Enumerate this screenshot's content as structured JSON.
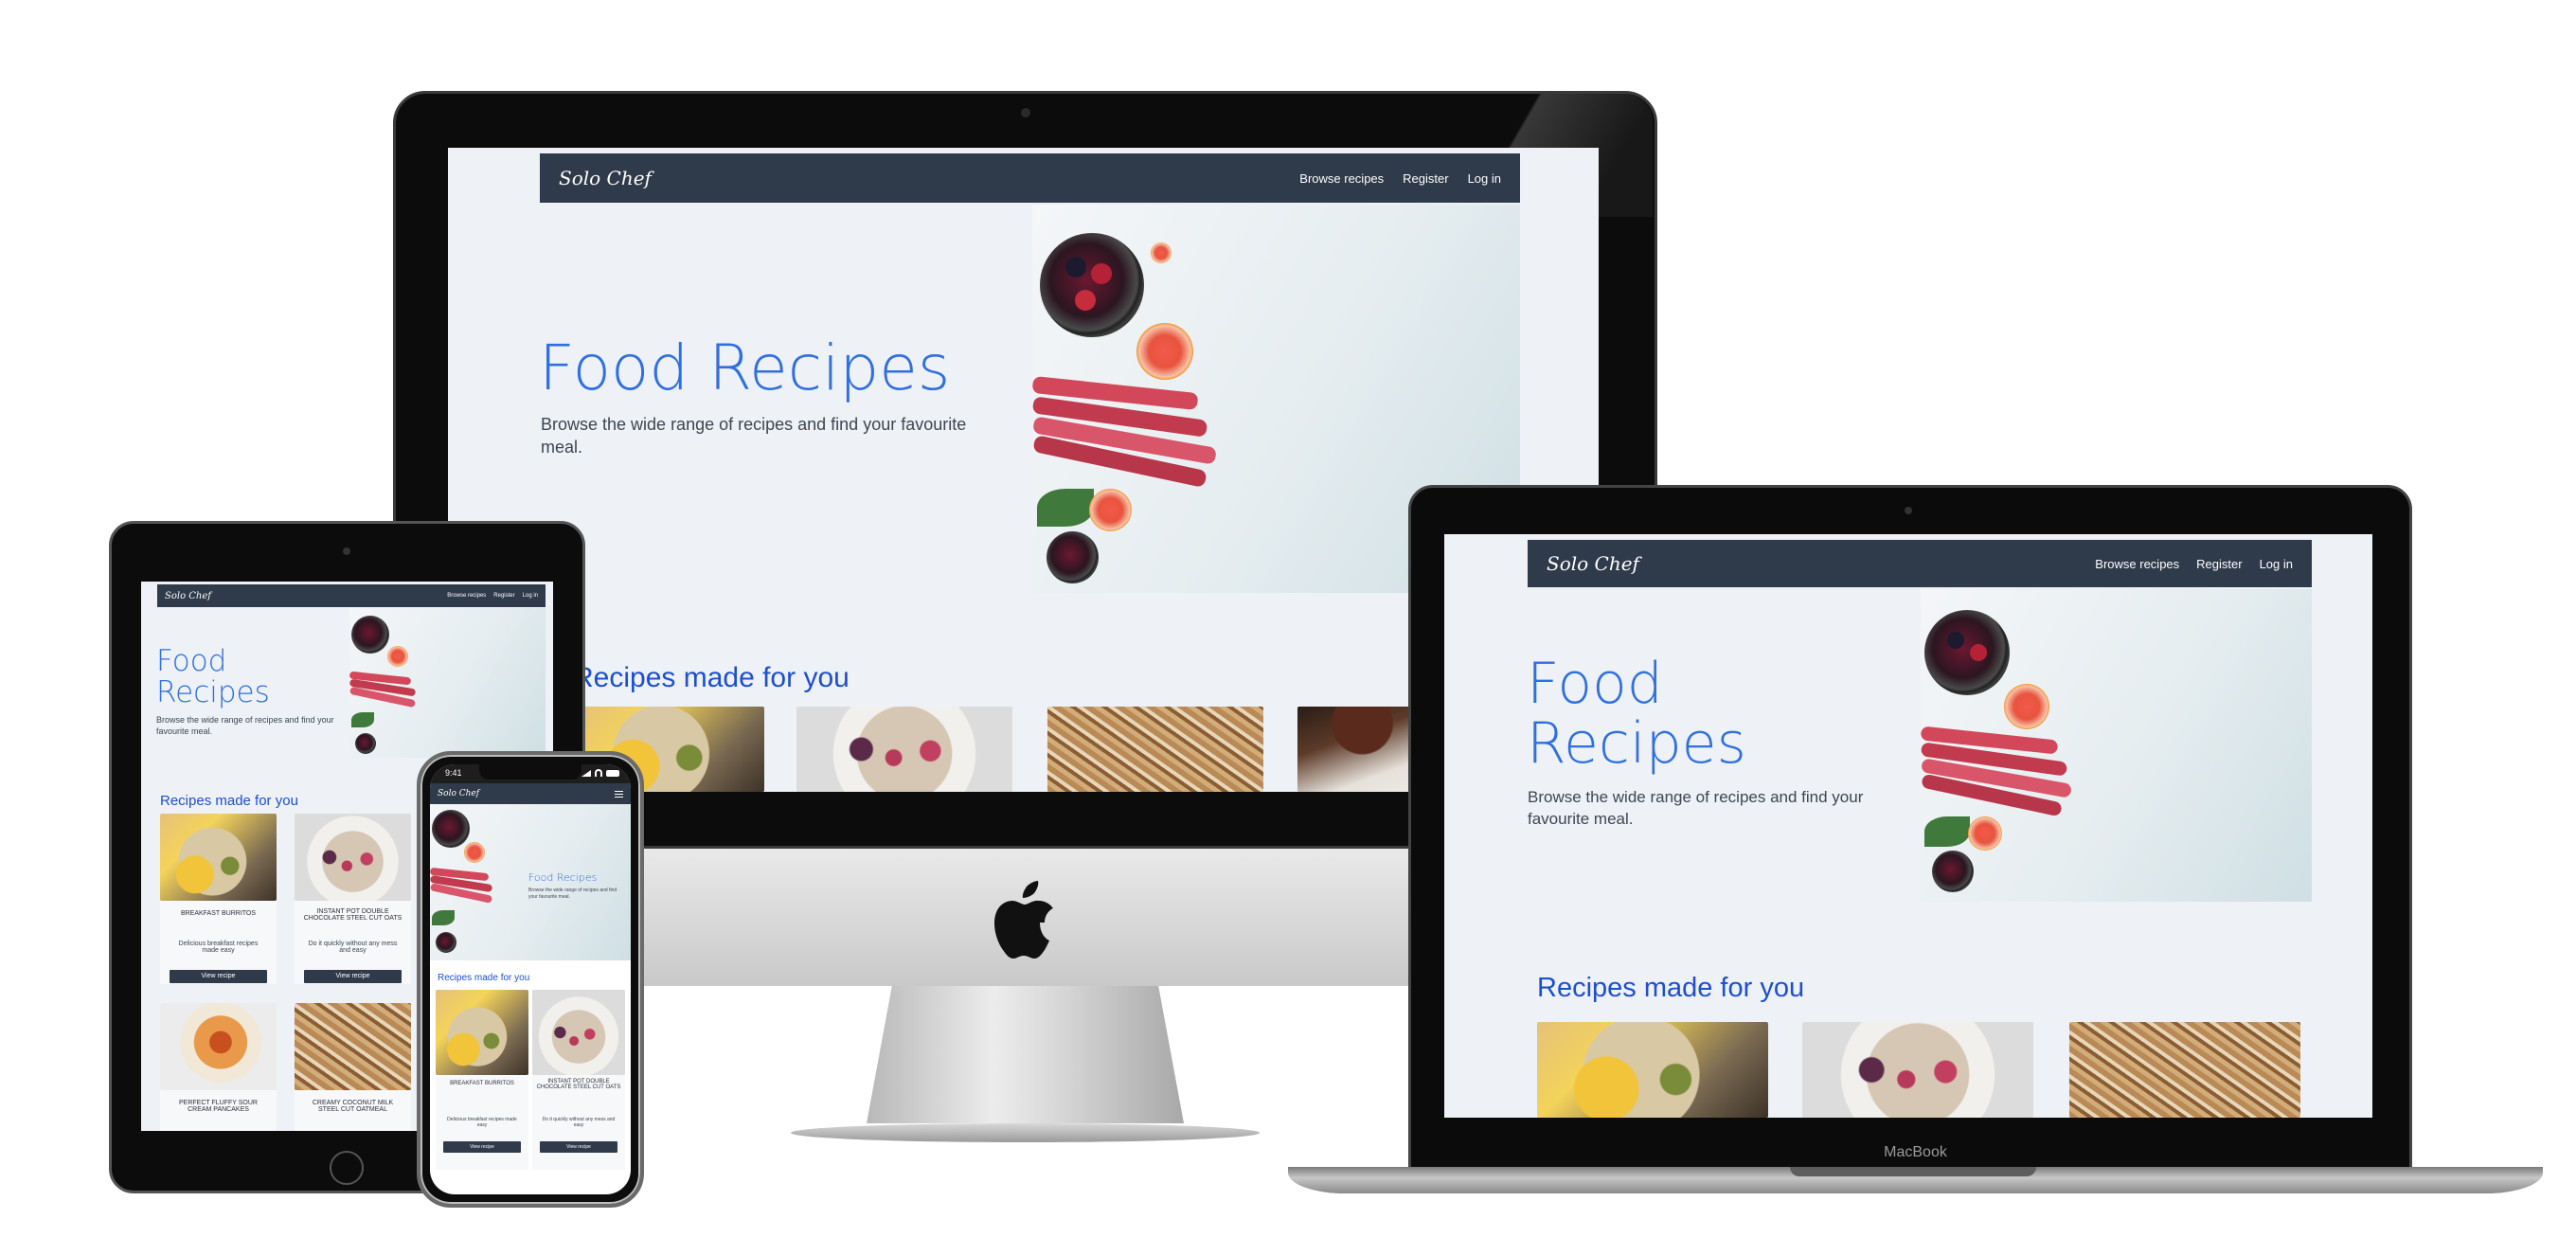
{
  "site": {
    "brand": "Solo Chef",
    "nav_links": [
      "Browse recipes",
      "Register",
      "Log in"
    ],
    "hero_title": "Food Recipes",
    "hero_subtitle": "Browse the wide range of recipes and find your favourite meal.",
    "section_title": "Recipes made for you",
    "view_recipe": "View recipe"
  },
  "recipes": [
    {
      "name": "BREAKFAST BURRITOS",
      "description": "Delicious breakfast recipes made easy"
    },
    {
      "name": "INSTANT POT DOUBLE CHOCOLATE STEEL CUT OATS",
      "description": "Do it quickly without any mess and easy"
    },
    {
      "name": "PERFECT FLUFFY SOUR CREAM PANCAKES",
      "description": ""
    },
    {
      "name": "CREAMY COCONUT MILK STEEL CUT OATMEAL",
      "description": ""
    }
  ],
  "phone": {
    "time": "9:41"
  },
  "laptop_label": "MacBook",
  "colors": {
    "navbar": "#2f3a4a",
    "accent_blue": "#2f6fe0",
    "section_blue": "#1c4fd1",
    "page_bg": "#eef1f5"
  },
  "icons": [
    "apple-logo-icon",
    "hamburger-menu-icon",
    "signal-icon",
    "wifi-icon",
    "battery-icon"
  ]
}
